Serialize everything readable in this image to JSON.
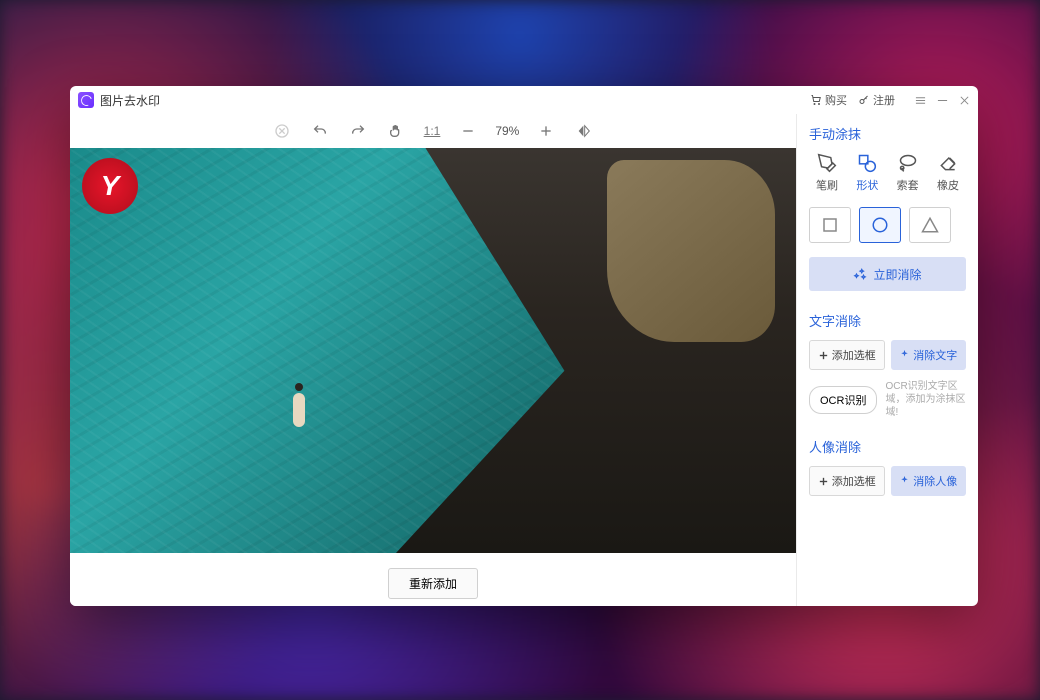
{
  "titlebar": {
    "app_name": "图片去水印",
    "buy": "购买",
    "register": "注册"
  },
  "toolbar": {
    "zoom_ratio": "1:1",
    "zoom_pct": "79%"
  },
  "canvas": {
    "logo_letter": "Y"
  },
  "bottom": {
    "re_add": "重新添加"
  },
  "sidebar": {
    "manual_title": "手动涂抹",
    "tools": {
      "brush": "笔刷",
      "shape": "形状",
      "lasso": "索套",
      "eraser": "橡皮"
    },
    "erase_now": "立即消除",
    "text_erase_title": "文字消除",
    "add_selection": "添加选框",
    "erase_text": "消除文字",
    "ocr_btn": "OCR识别",
    "ocr_desc": "OCR识别文字区域，添加为涂抹区域!",
    "portrait_title": "人像消除",
    "erase_portrait": "消除人像"
  }
}
